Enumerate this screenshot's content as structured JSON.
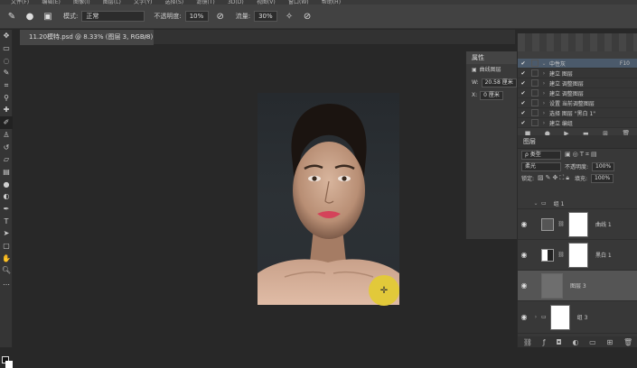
{
  "menubar": {
    "items": [
      "文件(F)",
      "编辑(E)",
      "图像(I)",
      "图层(L)",
      "文字(Y)",
      "选择(S)",
      "滤镜(T)",
      "3D(D)",
      "视图(V)",
      "窗口(W)",
      "帮助(H)"
    ]
  },
  "options": {
    "mode_label": "模式:",
    "mode_value": "正常",
    "opacity_label": "不透明度:",
    "opacity_value": "10%",
    "flow_label": "流量:",
    "flow_value": "30%"
  },
  "document_tab": {
    "title": "11.20模特.psd @ 8.33% (图层 3, RGB/8) *",
    "close": "×"
  },
  "properties": {
    "title": "属性",
    "sub": "曲线图层",
    "w_label": "W:",
    "w_value": "20.58 厘米",
    "x_label": "X:",
    "x_value": "0 厘米"
  },
  "history": {
    "rows": [
      {
        "check": "✔",
        "text": "中性灰",
        "key": "F10",
        "selected": true
      },
      {
        "check": "✔",
        "text": "建立 图层",
        "key": "",
        "selected": false
      },
      {
        "check": "✔",
        "text": "建立 调整图层",
        "key": "",
        "selected": false
      },
      {
        "check": "✔",
        "text": "建立 调整图层",
        "key": "",
        "selected": false
      },
      {
        "check": "✔",
        "text": "设置 当前调整图层",
        "key": "",
        "selected": false
      },
      {
        "check": "✔",
        "text": "选择 图层 \"黑白 1\"",
        "key": "",
        "selected": false
      },
      {
        "check": "✔",
        "text": "建立 编组",
        "key": "",
        "selected": false
      }
    ]
  },
  "layers": {
    "title": "图层",
    "filter_label": "ρ 类型",
    "blend_value": "柔光",
    "opacity_label": "不透明度:",
    "opacity_value": "100%",
    "lock_label": "锁定:",
    "fill_label": "填充:",
    "fill_value": "100%",
    "group_name": "组 1",
    "items": [
      {
        "name": "曲线 1",
        "type": "adjust"
      },
      {
        "name": "黑白 1",
        "type": "adjust"
      },
      {
        "name": "图层 3",
        "type": "pixel"
      },
      {
        "name": "组 3",
        "type": "group"
      }
    ]
  },
  "colors": {
    "accent_yellow": "#e2c93a",
    "selection_blue": "#4b5a6b"
  }
}
